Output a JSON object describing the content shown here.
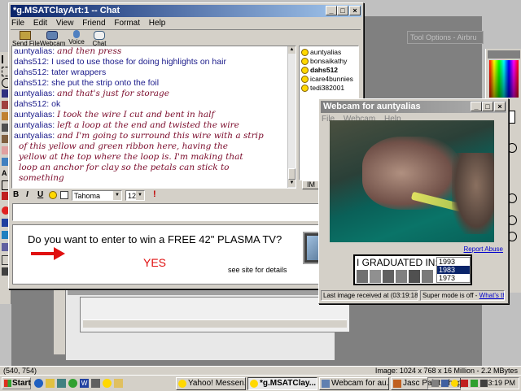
{
  "chat_window": {
    "title": "*g.MSATClayArt:1 -- Chat",
    "menu": [
      "File",
      "Edit",
      "View",
      "Friend",
      "Format",
      "Help"
    ],
    "toolbar": [
      {
        "label": "Send File",
        "icon": "send-file-icon"
      },
      {
        "label": "Webcam",
        "icon": "webcam-icon"
      },
      {
        "label": "Voice",
        "icon": "voice-icon"
      },
      {
        "label": "Chat",
        "icon": "chat-icon"
      }
    ],
    "messages": [
      {
        "user": "auntyalias:",
        "text": "and then press",
        "style": "cursive"
      },
      {
        "user": "dahs512:",
        "text": "I used to use those for doing highlights on hair",
        "style": "plain"
      },
      {
        "user": "dahs512:",
        "text": "tater wrappers",
        "style": "plain"
      },
      {
        "user": "dahs512:",
        "text": "she put the strip onto the foil",
        "style": "plain"
      },
      {
        "user": "auntyalias:",
        "text": "and that's just for storage",
        "style": "cursive"
      },
      {
        "user": "dahs512:",
        "text": "ok",
        "style": "plain"
      },
      {
        "user": "auntyalias:",
        "text": "I took the wire I cut and bent in half",
        "style": "cursive"
      },
      {
        "user": "auntyalias:",
        "text": "left a loop at the end and twisted the wire",
        "style": "cursive"
      },
      {
        "user": "auntyalias:",
        "text": "and I'm going to surround this wire with a strip",
        "style": "cursive"
      },
      {
        "user": "",
        "text": "of this yellow and green ribbon here, having the",
        "style": "cursive"
      },
      {
        "user": "",
        "text": "yellow at the top where the loop is. I'm making that",
        "style": "cursive"
      },
      {
        "user": "",
        "text": "loop an anchor for clay so the petals can stick to",
        "style": "cursive"
      },
      {
        "user": "",
        "text": "something",
        "style": "cursive"
      }
    ],
    "users": [
      {
        "name": "auntyalias",
        "bold": false
      },
      {
        "name": "bonsaikathy",
        "bold": false
      },
      {
        "name": "dahs512",
        "bold": true
      },
      {
        "name": "icare4bunnies",
        "bold": false
      },
      {
        "name": "tedi382001",
        "bold": false
      }
    ],
    "im_button": "IM",
    "format_bar": {
      "bold": "B",
      "italic": "I",
      "underline": "U",
      "font": "Tahoma",
      "size": "12"
    },
    "ad": {
      "headline": "Do you want to enter to win a FREE 42\" PLASMA TV?",
      "yes": "YES",
      "details": "see site for details"
    }
  },
  "webcam_window": {
    "title": "Webcam for auntyalias",
    "menu": [
      "File",
      "Webcam",
      "Help"
    ],
    "report_abuse": "Report Abuse",
    "ad": {
      "label": "I GRADUATED IN:",
      "years": [
        "1993",
        "1983",
        "1973"
      ],
      "selected": "1983"
    },
    "status": "Last image received at (03:19:18 PM)",
    "super_mode": "Super mode is off - ",
    "whats_this": "What's this?"
  },
  "tool_options": {
    "title": "Tool Options - Airbru"
  },
  "status_bar": {
    "coords": "(540, 754)",
    "image_info": "Image:  1024 x 768 x 16 Million - 2.2 MBytes"
  },
  "taskbar": {
    "start": "Start",
    "tasks": [
      {
        "label": "Yahoo! Messen...",
        "active": false
      },
      {
        "label": "*g.MSATClay...",
        "active": true
      },
      {
        "label": "Webcam for au...",
        "active": false
      },
      {
        "label": "Jasc Paint Shop...",
        "active": false
      }
    ],
    "clock": "3:19 PM"
  }
}
